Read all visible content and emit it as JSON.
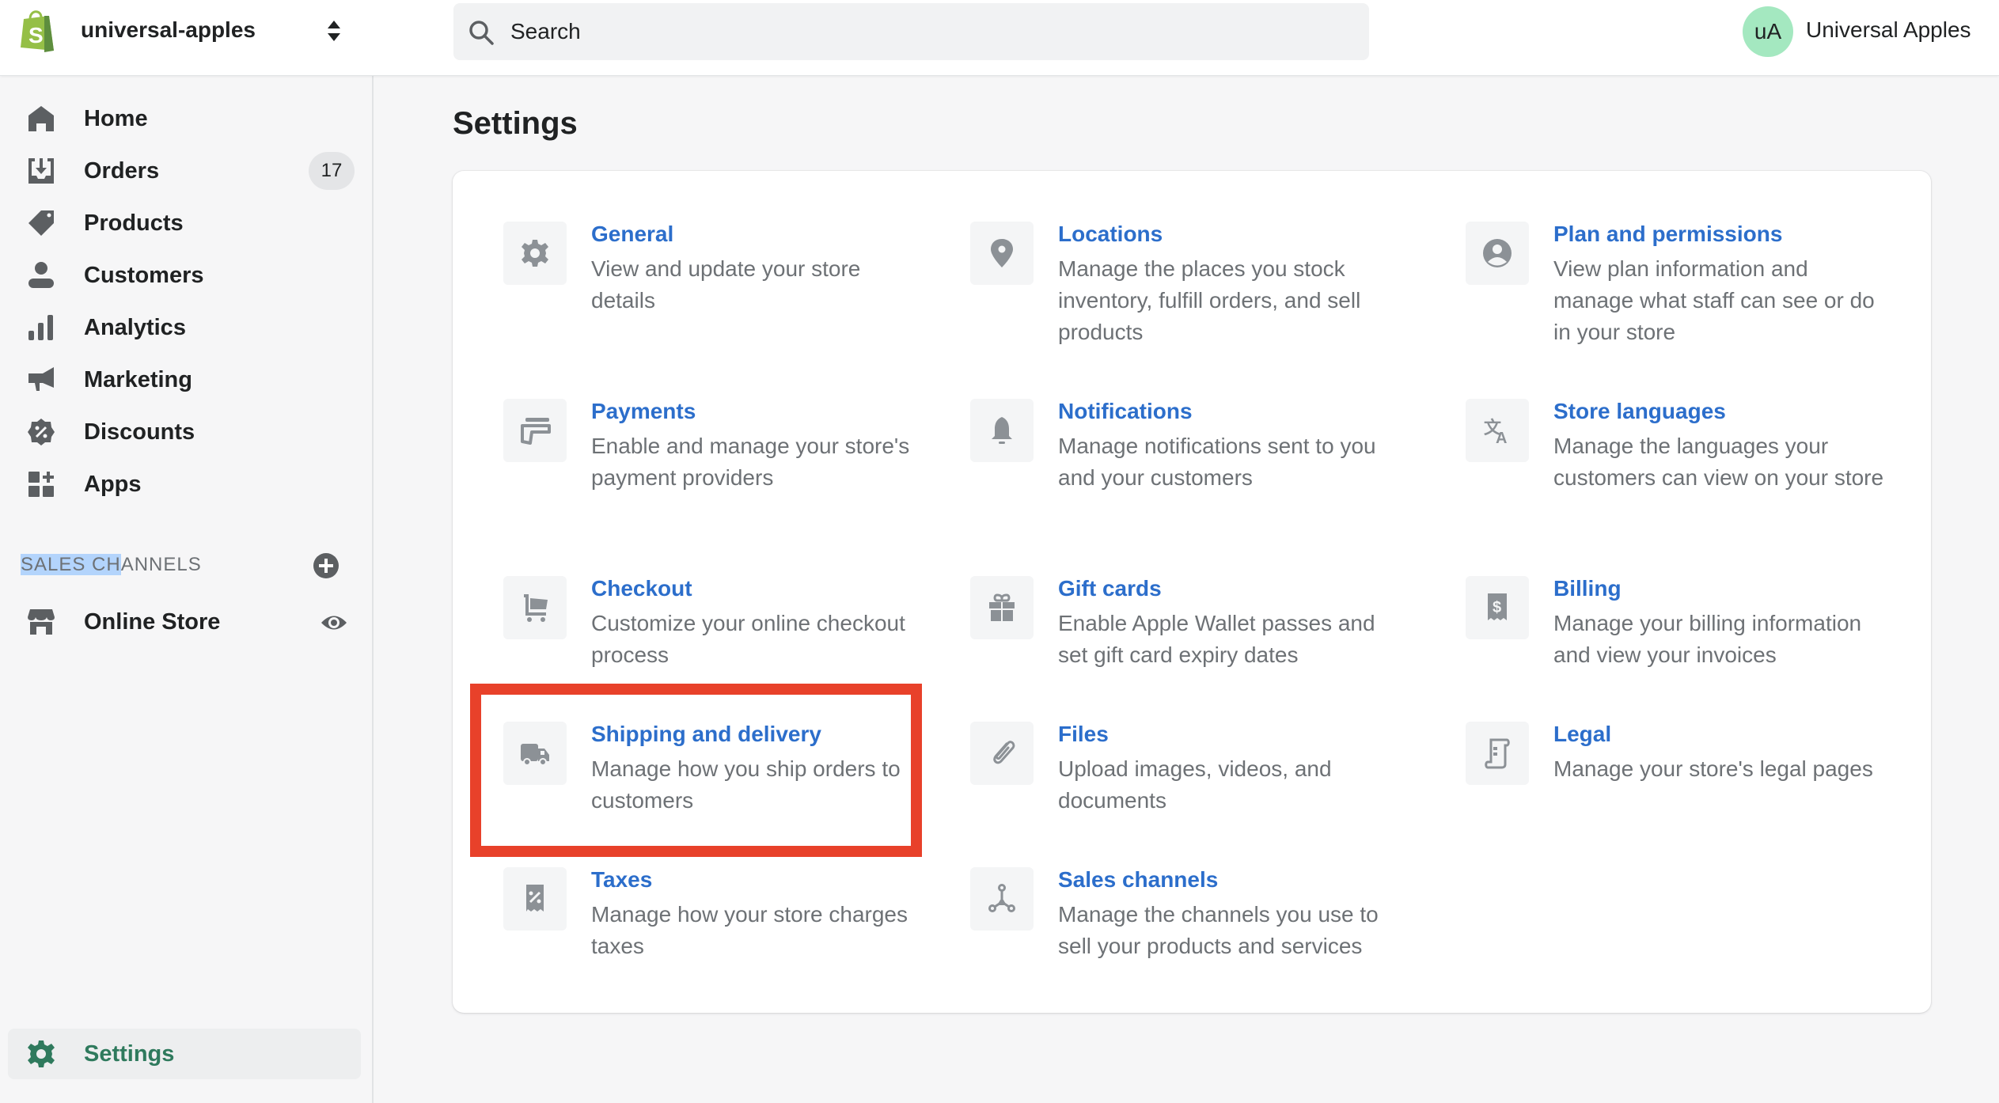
{
  "topbar": {
    "store_name": "universal-apples",
    "search_placeholder": "Search",
    "avatar_initials": "uA",
    "user_name": "Universal Apples"
  },
  "sidebar": {
    "items": [
      {
        "label": "Home",
        "icon": "home-icon"
      },
      {
        "label": "Orders",
        "icon": "orders-icon",
        "badge": "17"
      },
      {
        "label": "Products",
        "icon": "tag-icon"
      },
      {
        "label": "Customers",
        "icon": "person-icon"
      },
      {
        "label": "Analytics",
        "icon": "bar-chart-icon"
      },
      {
        "label": "Marketing",
        "icon": "megaphone-icon"
      },
      {
        "label": "Discounts",
        "icon": "discount-icon"
      },
      {
        "label": "Apps",
        "icon": "apps-icon"
      }
    ],
    "sales_channels": {
      "header_selected": "SALES CH",
      "header_rest": "ANNELS",
      "items": [
        {
          "label": "Online Store",
          "icon": "store-icon"
        }
      ]
    },
    "settings": {
      "label": "Settings",
      "icon": "gear-icon"
    }
  },
  "main": {
    "title": "Settings",
    "settings": [
      {
        "title": "General",
        "desc": "View and update your store details",
        "icon": "gear-icon"
      },
      {
        "title": "Locations",
        "desc": "Manage the places you stock inventory, fulfill orders, and sell products",
        "icon": "location-pin-icon"
      },
      {
        "title": "Plan and permissions",
        "desc": "View plan information and manage what staff can see or do in your store",
        "icon": "user-circle-icon"
      },
      {
        "title": "Payments",
        "desc": "Enable and manage your store's payment providers",
        "icon": "payment-card-icon"
      },
      {
        "title": "Notifications",
        "desc": "Manage notifications sent to you and your customers",
        "icon": "bell-icon"
      },
      {
        "title": "Store languages",
        "desc": "Manage the languages your customers can view on your store",
        "icon": "translate-icon"
      },
      {
        "title": "Checkout",
        "desc": "Customize your online checkout process",
        "icon": "cart-icon"
      },
      {
        "title": "Gift cards",
        "desc": "Enable Apple Wallet passes and set gift card expiry dates",
        "icon": "gift-icon"
      },
      {
        "title": "Billing",
        "desc": "Manage your billing information and view your invoices",
        "icon": "billing-receipt-icon"
      },
      {
        "title": "Shipping and delivery",
        "desc": "Manage how you ship orders to customers",
        "icon": "truck-icon"
      },
      {
        "title": "Files",
        "desc": "Upload images, videos, and documents",
        "icon": "paperclip-icon"
      },
      {
        "title": "Legal",
        "desc": "Manage your store's legal pages",
        "icon": "legal-scroll-icon"
      },
      {
        "title": "Taxes",
        "desc": "Manage how your store charges taxes",
        "icon": "tax-receipt-icon"
      },
      {
        "title": "Sales channels",
        "desc": "Manage the channels you use to sell your products and services",
        "icon": "sales-channels-icon"
      }
    ],
    "highlighted_item": "Shipping and delivery"
  },
  "colors": {
    "link_blue": "#2c6ecb",
    "settings_active_green": "#2f7a5d",
    "highlight_red": "#e8412a",
    "avatar_green": "#a4e8c0"
  }
}
